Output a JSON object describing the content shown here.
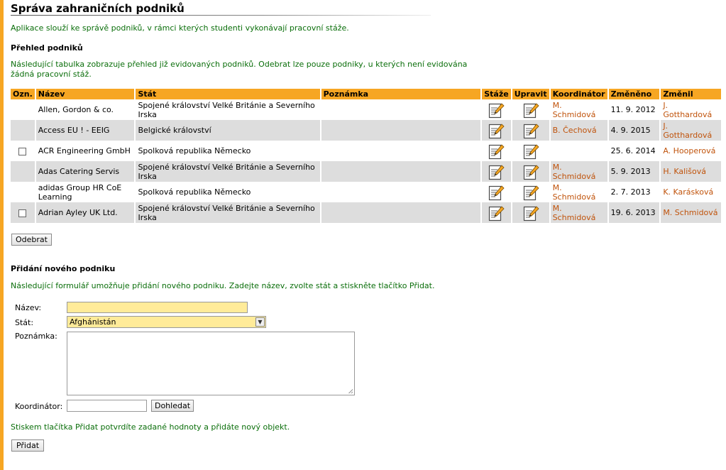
{
  "page": {
    "title": "Správa zahraničních podniků",
    "intro": "Aplikace slouží ke správě podniků, v rámci kterých studenti vykonávají pracovní stáže."
  },
  "overview": {
    "heading": "Přehled podniků",
    "description": "Následující tabulka zobrazuje přehled již evidovaných podniků. Odebrat lze pouze podniky, u kterých není evidována žádná pracovní stáž.",
    "columns": [
      "Ozn.",
      "Název",
      "Stát",
      "Poznámka",
      "Stáže",
      "Upravit",
      "Koordinátor",
      "Změněno",
      "Změnil"
    ],
    "rows": [
      {
        "name": "Allen, Gordon & co.",
        "state": "Spojené království Velké Británie a Severního Irska",
        "note": "",
        "coordinator": "M. Schmidová",
        "changed": "11. 9. 2012",
        "changed_by": "J. Gotthardová"
      },
      {
        "name": "Access EU ! - EEIG",
        "state": "Belgické království",
        "note": "",
        "coordinator": "B. Čechová",
        "changed": "4. 9. 2015",
        "changed_by": "J. Gotthardová"
      },
      {
        "name": "ACR Engineering GmbH",
        "state": "Spolková republika Německo",
        "note": "",
        "coordinator": "",
        "changed": "25. 6. 2014",
        "changed_by": "A. Hooperová"
      },
      {
        "name": "Adas Catering Servis",
        "state": "Spojené království Velké Británie a Severního Irska",
        "note": "",
        "coordinator": "M. Schmidová",
        "changed": "5. 9. 2013",
        "changed_by": "H. Kališová"
      },
      {
        "name": "adidas Group HR CoE Learning",
        "state": "Spolková republika Německo",
        "note": "",
        "coordinator": "M. Schmidová",
        "changed": "2. 7. 2013",
        "changed_by": "K. Karásková"
      },
      {
        "name": "Adrian Ayley UK Ltd.",
        "state": "Spojené království Velké Británie a Severního Irska",
        "note": "",
        "coordinator": "M. Schmidová",
        "changed": "19. 6. 2013",
        "changed_by": "M. Schmidová"
      }
    ],
    "remove_button": "Odebrat"
  },
  "add_form": {
    "heading": "Přidání nového podniku",
    "description": "Následující formulář umožňuje přidání nového podniku. Zadejte název, zvolte stát a stiskněte tlačítko Přidat.",
    "name_label": "Název:",
    "name_value": "",
    "state_label": "Stát:",
    "state_value": "Afghánistán",
    "note_label": "Poznámka:",
    "note_value": "",
    "coordinator_label": "Koordinátor:",
    "coordinator_value": "",
    "search_button": "Dohledat",
    "confirm_text": "Stiskem tlačítka Přidat potvrdíte zadané hodnoty a přidáte nový objekt.",
    "add_button": "Přidat"
  },
  "colors": {
    "accent": "#f6a623",
    "green_text": "#0a6e0a",
    "link": "#c0530b",
    "row_alt": "#dddddd",
    "input_required": "#ffeb99"
  },
  "icons": {
    "edit": "edit-document-icon",
    "select_arrow": "chevron-down-icon"
  }
}
